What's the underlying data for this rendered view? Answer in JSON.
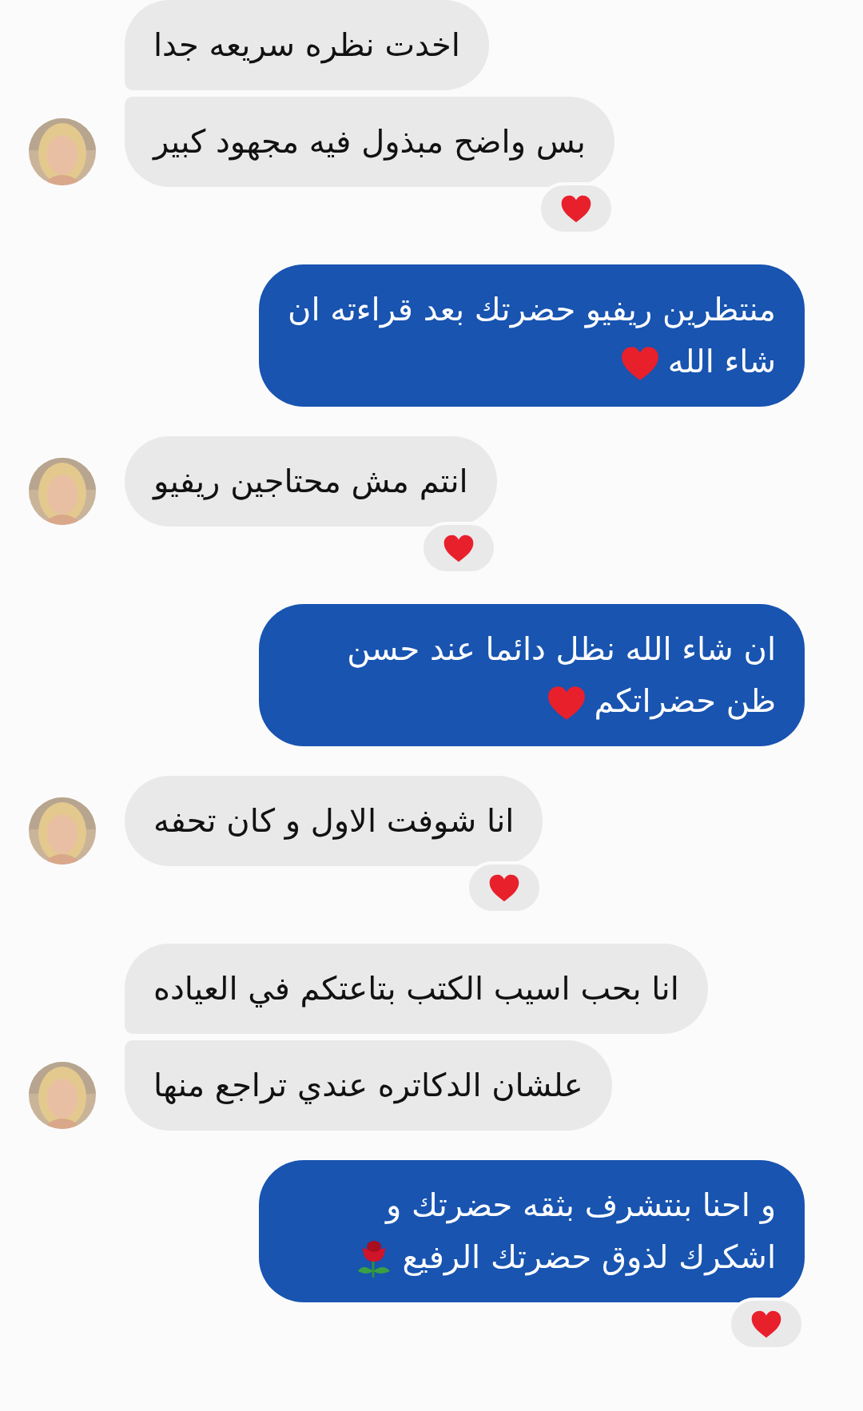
{
  "messages": [
    {
      "kind": "received",
      "avatar": false,
      "text": "اخدت نظره سريعه جدا",
      "reacted": false,
      "heart_after": false,
      "rose_after": false
    },
    {
      "kind": "received",
      "avatar": true,
      "text": "بس واضح مبذول فيه مجهود كبير",
      "reacted": true,
      "heart_after": false,
      "rose_after": false
    },
    {
      "kind": "sent",
      "text": "منتظرين ريفيو حضرتك بعد قراءته ان شاء الله",
      "reacted": false,
      "heart_after": true,
      "rose_after": false
    },
    {
      "kind": "received",
      "avatar": true,
      "text": "انتم مش محتاجين ريفيو",
      "reacted": true,
      "heart_after": false,
      "rose_after": false
    },
    {
      "kind": "sent",
      "text": "ان شاء الله نظل دائما عند حسن ظن حضراتكم",
      "reacted": false,
      "heart_after": true,
      "rose_after": false
    },
    {
      "kind": "received",
      "avatar": true,
      "text": "انا شوفت الاول و كان تحفه",
      "reacted": true,
      "heart_after": false,
      "rose_after": false
    },
    {
      "kind": "received",
      "avatar": false,
      "text": "انا بحب اسيب الكتب بتاعتكم في العياده",
      "reacted": false,
      "heart_after": false,
      "rose_after": false
    },
    {
      "kind": "received",
      "avatar": true,
      "text": "علشان الدكاتره عندي تراجع منها",
      "reacted": false,
      "heart_after": false,
      "rose_after": false
    },
    {
      "kind": "sent",
      "text": "و احنا بنتشرف بثقه حضرتك و اشكرك لذوق حضرتك الرفيع",
      "reacted": true,
      "heart_after": false,
      "rose_after": true
    }
  ]
}
